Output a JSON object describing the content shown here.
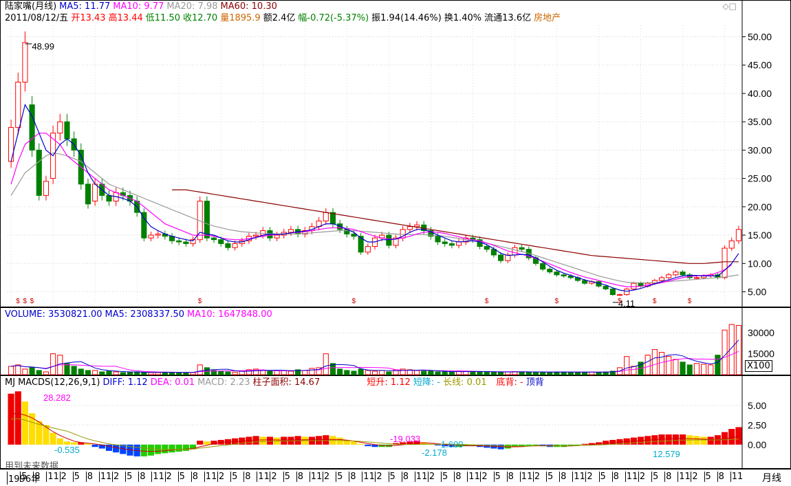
{
  "price_header": {
    "title": "陆家嘴(月线)",
    "ma5": "MA5: 11.77",
    "ma10": "MA10: 9.77",
    "ma20": "MA20: 7.98",
    "ma60": "MA60: 10.30",
    "line2": {
      "date": "2011/08/12/五",
      "open": "开13.43",
      "high": "高13.44",
      "low": "低11.50",
      "close": "收12.70",
      "vol": "量1895.9",
      "amount": "额2.4亿",
      "change": "幅-0.72(-5.37%)",
      "amplitude": "振1.94(14.46%)",
      "turnover": "换1.40%",
      "float": "流通13.6亿",
      "sector": "房地产"
    },
    "high_marker": "48.99",
    "low_marker": "4.11"
  },
  "volume_header": {
    "volume": "VOLUME: 3530821.00",
    "ma5": "MA5: 2308337.50",
    "ma10": "MA10: 1647848.00",
    "unit": "X100"
  },
  "macd_header": {
    "name": "MJ",
    "params": "MACDS(12,26,9,1)",
    "diff": "DIFF: 1.12",
    "dea": "DEA: 0.01",
    "macd": "MACD: 2.23",
    "area": "柱子面积: 14.67",
    "short_up": "短升: 1.12",
    "short_down": "短降: -",
    "long_line": "长线: 0.01",
    "bottom_div": "底背: -",
    "top_div": "顶背",
    "peak_label": "28.282",
    "labels": [
      "-0.535",
      "-19.033",
      "1.600",
      "-2.178",
      "12.579"
    ],
    "footnote": "用到未来数据"
  },
  "time_axis": {
    "labels": [
      "1996年",
      "5",
      "8",
      "11",
      "2",
      "5",
      "8",
      "11",
      "2",
      "5",
      "8",
      "11",
      "2",
      "5",
      "8",
      "11",
      "2",
      "5",
      "8",
      "11",
      "2",
      "5",
      "8",
      "11",
      "2",
      "5",
      "8",
      "11",
      "2",
      "5",
      "8",
      "11",
      "2",
      "5",
      "8",
      "11",
      "2",
      "5",
      "8",
      "11",
      "2",
      "5",
      "8",
      "11",
      "2",
      "5",
      "8",
      "11",
      "2",
      "5",
      "8",
      "11",
      "2",
      "5",
      "8",
      "11"
    ],
    "period": "月线"
  },
  "colors": {
    "up": "#ff0000",
    "down": "#008000",
    "ma5": "#0000cc",
    "ma10": "#ff00ff",
    "ma20": "#999999",
    "ma60": "#8b0000"
  },
  "chart_data": [
    {
      "type": "candlestick",
      "title": "陆家嘴(月线)",
      "yaxis_ticks": [
        5.0,
        10.0,
        15.0,
        20.0,
        25.0,
        30.0,
        35.0,
        40.0,
        45.0,
        50.0
      ],
      "ylim": [
        3,
        52
      ],
      "x_unit": "month",
      "close": [
        34.0,
        42.0,
        48.99,
        30.0,
        22.0,
        24.5,
        33.0,
        35.0,
        32.0,
        30.0,
        24.0,
        20.5,
        24.0,
        22.0,
        21.0,
        22.5,
        22.0,
        21.0,
        19.0,
        14.5,
        15.0,
        15.2,
        14.8,
        14.0,
        13.8,
        13.5,
        14.2,
        21.0,
        14.5,
        14.2,
        13.5,
        12.8,
        13.5,
        14.0,
        14.8,
        15.0,
        15.8,
        14.5,
        15.0,
        15.5,
        16.0,
        15.2,
        15.8,
        16.5,
        17.5,
        19.0,
        17.0,
        16.0,
        15.2,
        14.8,
        12.0,
        13.0,
        14.5,
        15.0,
        13.2,
        14.5,
        16.0,
        16.5,
        16.8,
        15.8,
        14.8,
        13.8,
        13.5,
        13.2,
        13.8,
        14.5,
        14.2,
        13.0,
        12.5,
        11.5,
        10.5,
        11.5,
        12.8,
        12.5,
        11.0,
        10.0,
        9.0,
        8.5,
        8.0,
        7.8,
        7.5,
        7.0,
        6.5,
        6.8,
        6.0,
        5.5,
        4.5,
        4.5,
        5.5,
        6.5,
        6.0,
        6.5,
        7.0,
        7.5,
        8.0,
        8.5,
        8.0,
        7.5,
        7.5,
        7.8,
        8.0,
        7.5,
        12.7,
        14.0,
        16.0
      ],
      "open": [
        28.0,
        34.0,
        42.0,
        38.0,
        30.0,
        22.0,
        25.0,
        33.0,
        35.0,
        32.0,
        30.0,
        24.0,
        21.0,
        24.0,
        22.0,
        21.0,
        22.5,
        22.0,
        21.0,
        19.0,
        14.5,
        15.0,
        15.2,
        14.8,
        14.0,
        13.8,
        13.5,
        14.2,
        21.0,
        14.5,
        14.2,
        13.5,
        12.8,
        13.5,
        14.0,
        14.8,
        15.0,
        15.8,
        14.5,
        15.0,
        15.5,
        16.0,
        15.2,
        15.8,
        16.5,
        17.5,
        19.0,
        17.0,
        16.0,
        15.2,
        14.8,
        12.0,
        13.0,
        14.5,
        15.0,
        13.2,
        14.5,
        16.0,
        16.5,
        16.8,
        15.8,
        14.8,
        13.8,
        13.5,
        13.2,
        13.8,
        14.5,
        14.2,
        13.0,
        12.5,
        11.5,
        10.5,
        11.5,
        12.8,
        12.5,
        11.0,
        10.0,
        9.0,
        8.5,
        8.0,
        7.8,
        7.5,
        7.0,
        6.5,
        6.8,
        6.0,
        5.5,
        4.5,
        4.5,
        5.5,
        6.5,
        6.0,
        6.5,
        7.0,
        7.5,
        8.0,
        8.5,
        8.0,
        7.5,
        7.5,
        7.8,
        8.0,
        7.5,
        12.7,
        14.0
      ],
      "ma5": [
        28,
        33,
        38,
        36,
        33,
        30,
        29,
        31,
        32,
        31,
        29,
        26,
        24,
        23,
        22,
        21.8,
        21.5,
        21,
        20,
        18,
        16.5,
        15.8,
        15.2,
        14.8,
        14.5,
        14.2,
        14,
        15.5,
        15.2,
        15,
        14.5,
        14,
        13.8,
        13.8,
        14.2,
        14.6,
        15,
        15.2,
        15.1,
        15.2,
        15.4,
        15.6,
        15.7,
        16,
        16.5,
        17,
        17,
        16.6,
        16,
        15.5,
        14.5,
        13.8,
        13.8,
        14.2,
        14.2,
        14.3,
        14.8,
        15.5,
        16,
        16,
        15.6,
        15,
        14.5,
        14,
        13.8,
        13.9,
        14,
        13.8,
        13.3,
        12.6,
        11.8,
        11.4,
        11.5,
        11.6,
        11.5,
        11,
        10.3,
        9.5,
        8.8,
        8.3,
        7.9,
        7.5,
        7.1,
        6.8,
        6.5,
        6.2,
        5.7,
        5.3,
        5.1,
        5.3,
        5.6,
        6,
        6.4,
        6.8,
        7.1,
        7.5,
        7.8,
        7.9,
        7.9,
        7.8,
        7.8,
        7.8,
        8.8,
        10,
        11.77
      ],
      "ma10": [
        24,
        28,
        31,
        32,
        33,
        33,
        32,
        31,
        29,
        28,
        27,
        26,
        25,
        24,
        23,
        22.5,
        22,
        21.5,
        21,
        20,
        19,
        18,
        17,
        16.5,
        16,
        15.5,
        15,
        15,
        15,
        14.8,
        14.5,
        14.3,
        14.2,
        14.2,
        14.4,
        14.6,
        14.8,
        15,
        15.1,
        15.2,
        15.4,
        15.5,
        15.6,
        15.8,
        16,
        16.2,
        16.3,
        16.3,
        16.2,
        16,
        15.6,
        15.2,
        14.8,
        14.5,
        14.3,
        14.3,
        14.5,
        14.8,
        15.2,
        15.5,
        15.6,
        15.5,
        15.3,
        15,
        14.7,
        14.4,
        14.2,
        14,
        13.6,
        13.2,
        12.7,
        12.2,
        11.9,
        11.6,
        11.3,
        10.9,
        10.4,
        9.9,
        9.4,
        8.9,
        8.4,
        8,
        7.6,
        7.3,
        7,
        6.7,
        6.4,
        6.1,
        5.9,
        5.9,
        6,
        6.2,
        6.4,
        6.6,
        6.9,
        7.2,
        7.5,
        7.7,
        7.8,
        7.9,
        8,
        8.4,
        8.9,
        9.77
      ],
      "ma20": [
        22,
        24,
        26,
        27,
        28,
        29,
        29.5,
        29.3,
        29,
        28.5,
        28,
        27,
        26,
        25,
        24,
        23.5,
        23,
        22.5,
        22,
        21.5,
        21,
        20.5,
        20,
        19.5,
        19,
        18.5,
        18,
        17.5,
        17,
        16.6,
        16.3,
        16,
        15.8,
        15.6,
        15.5,
        15.4,
        15.3,
        15.3,
        15.2,
        15.2,
        15.2,
        15.2,
        15.3,
        15.4,
        15.5,
        15.6,
        15.7,
        15.8,
        15.8,
        15.8,
        15.7,
        15.6,
        15.5,
        15.4,
        15.3,
        15.2,
        15.1,
        15.1,
        15.1,
        15.1,
        15,
        14.9,
        14.8,
        14.6,
        14.4,
        14.2,
        14,
        13.8,
        13.6,
        13.3,
        13,
        12.7,
        12.4,
        12.1,
        11.8,
        11.4,
        11,
        10.6,
        10.2,
        9.8,
        9.4,
        9,
        8.6,
        8.2,
        7.8,
        7.5,
        7.2,
        6.9,
        6.7,
        6.6,
        6.6,
        6.6,
        6.6,
        6.7,
        6.8,
        6.9,
        7,
        7.1,
        7.2,
        7.3,
        7.4,
        7.5,
        7.6,
        7.8,
        7.98
      ],
      "ma60": [
        null,
        null,
        null,
        null,
        null,
        null,
        null,
        null,
        null,
        null,
        null,
        null,
        null,
        null,
        null,
        null,
        null,
        null,
        null,
        null,
        null,
        null,
        null,
        23,
        23,
        23,
        22.8,
        22.6,
        22.4,
        22.2,
        22,
        21.8,
        21.6,
        21.4,
        21.2,
        21,
        20.8,
        20.6,
        20.4,
        20.2,
        20,
        19.8,
        19.6,
        19.4,
        19.2,
        19,
        18.8,
        18.6,
        18.4,
        18.2,
        18,
        17.8,
        17.6,
        17.4,
        17.2,
        17,
        16.8,
        16.6,
        16.4,
        16.2,
        16,
        15.8,
        15.6,
        15.4,
        15.2,
        15,
        14.8,
        14.6,
        14.4,
        14.2,
        14,
        13.8,
        13.6,
        13.4,
        13.2,
        13,
        12.8,
        12.6,
        12.4,
        12.2,
        12,
        11.8,
        11.6,
        11.4,
        11.3,
        11.2,
        11.1,
        11,
        10.9,
        10.8,
        10.7,
        10.6,
        10.5,
        10.4,
        10.3,
        10.2,
        10.1,
        10,
        10,
        10,
        10.1,
        10.2,
        10.3,
        10.3,
        10.3
      ]
    },
    {
      "type": "bar",
      "title": "VOLUME",
      "yaxis_ticks": [
        15000,
        30000
      ],
      "ylim": [
        0,
        38000
      ],
      "values": [
        6000,
        7000,
        4000,
        5000,
        3000,
        2000,
        15000,
        14000,
        8000,
        6000,
        4000,
        3000,
        3000,
        2000,
        2500,
        2000,
        1500,
        1800,
        2000,
        1500,
        1500,
        1500,
        1800,
        1500,
        1500,
        1500,
        1500,
        7000,
        5000,
        3000,
        2500,
        2000,
        1800,
        2500,
        3500,
        4000,
        3000,
        2500,
        3000,
        3000,
        2500,
        3500,
        3000,
        4500,
        5000,
        15000,
        8000,
        4000,
        3000,
        2500,
        4000,
        3000,
        2500,
        3000,
        2000,
        3500,
        4000,
        3500,
        3000,
        2500,
        2500,
        2000,
        2000,
        1800,
        2500,
        2500,
        2200,
        2000,
        1800,
        2000,
        1800,
        2000,
        2200,
        2000,
        1800,
        1800,
        1800,
        1800,
        2000,
        2000,
        1800,
        1800,
        1800,
        1800,
        1800,
        2000,
        2500,
        5000,
        13000,
        6000,
        9000,
        14000,
        18000,
        16000,
        13000,
        11000,
        9000,
        7000,
        8000,
        7500,
        7000,
        14000,
        32000,
        36000,
        35308
      ]
    },
    {
      "type": "bar",
      "title": "MACDS(12,26,9,1)",
      "yaxis_ticks": [
        0.0,
        2.5,
        5.0
      ],
      "ylim": [
        -3,
        7
      ],
      "values": [
        6.5,
        6.8,
        5.5,
        4.0,
        3.0,
        2.5,
        1.5,
        0.8,
        0.4,
        0.3,
        0.3,
        0.2,
        -0.3,
        -0.5,
        -0.8,
        -1.0,
        -1.2,
        -1.4,
        -1.5,
        -1.5,
        -1.4,
        -1.2,
        -1.1,
        -1.0,
        -0.9,
        -0.8,
        -0.6,
        0.5,
        0.4,
        0.5,
        0.6,
        0.7,
        0.8,
        0.9,
        1.0,
        1.1,
        1.0,
        1.0,
        0.9,
        1.0,
        1.0,
        1.1,
        1.0,
        1.0,
        1.1,
        1.2,
        1.1,
        0.9,
        0.6,
        0.4,
        0.1,
        -0.2,
        -0.3,
        -0.3,
        -0.3,
        0.2,
        0.3,
        0.4,
        0.5,
        0.3,
        0.1,
        -0.1,
        -0.2,
        -0.3,
        -0.3,
        -0.2,
        -0.2,
        -0.3,
        -0.4,
        -0.5,
        -0.6,
        -0.5,
        -0.3,
        -0.3,
        -0.2,
        -0.1,
        -0.2,
        -0.3,
        -0.3,
        -0.3,
        -0.2,
        -0.1,
        0.1,
        0.2,
        0.3,
        0.5,
        0.6,
        0.7,
        0.8,
        0.9,
        1.0,
        1.1,
        1.2,
        1.3,
        1.3,
        1.3,
        1.3,
        1.2,
        1.1,
        1.0,
        1.0,
        1.2,
        1.6,
        2.0,
        2.23
      ]
    }
  ]
}
